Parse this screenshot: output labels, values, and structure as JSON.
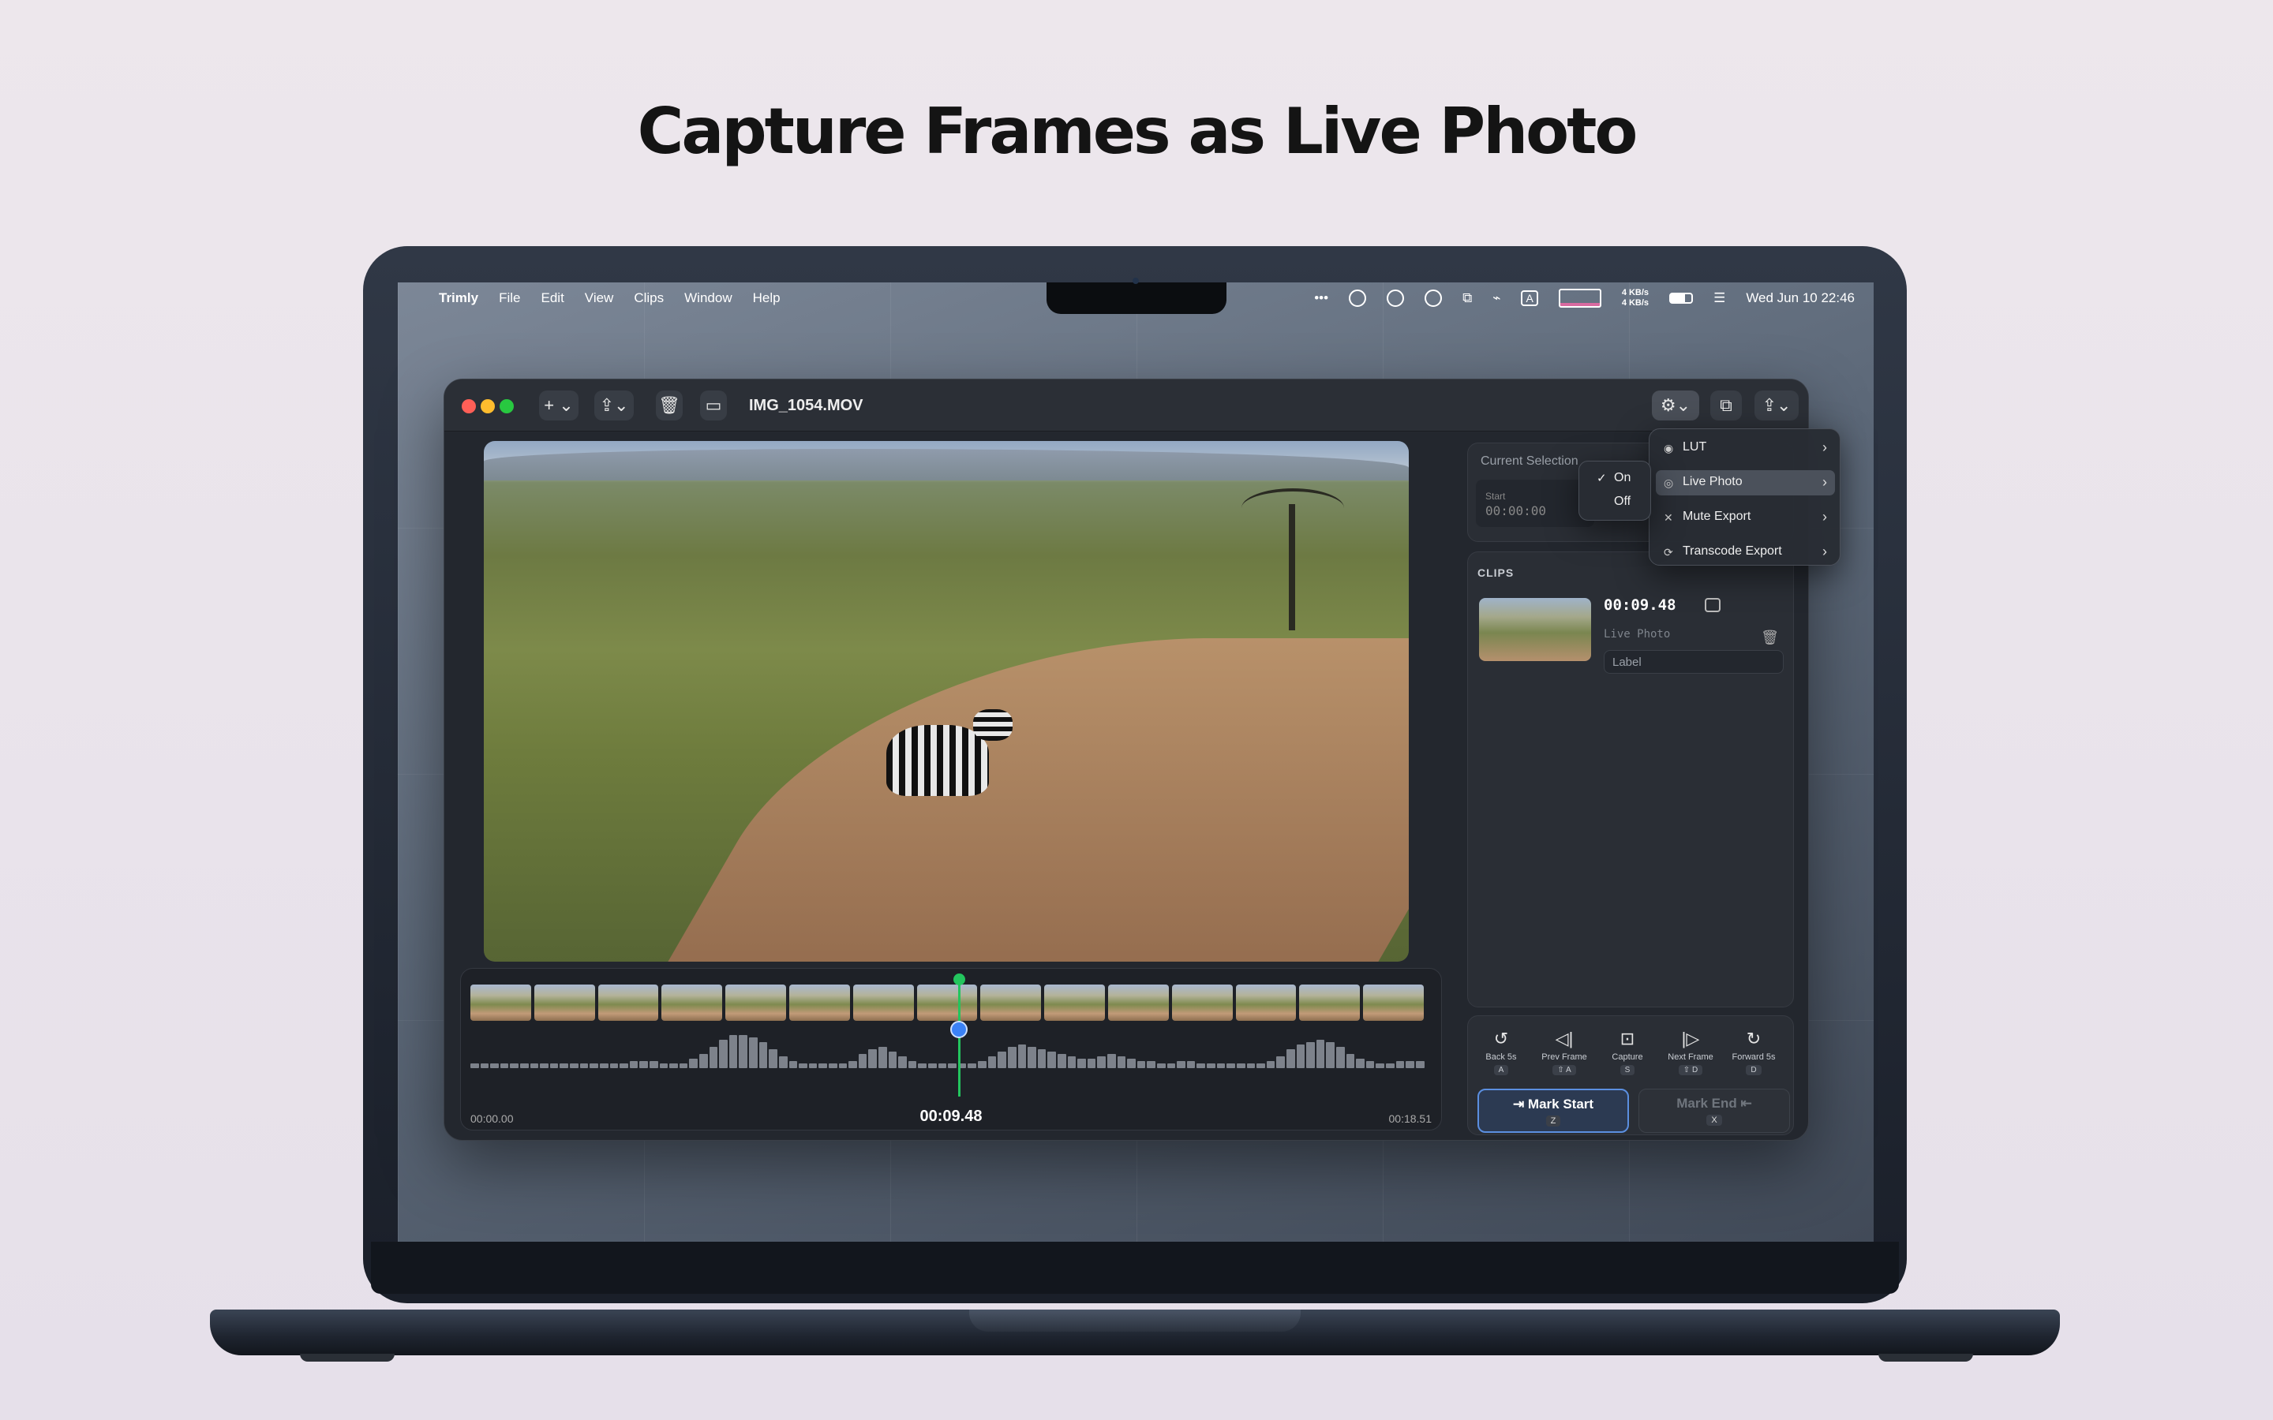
{
  "headline": "Capture Frames as Live Photo",
  "menubar": {
    "app": "Trimly",
    "items": [
      "File",
      "Edit",
      "View",
      "Clips",
      "Window",
      "Help"
    ],
    "net_up": "4 KB/s",
    "net_down": "4 KB/s",
    "clock": "Wed Jun 10  22:46"
  },
  "window": {
    "title": "IMG_1054.MOV",
    "toolbar_icons": [
      "add-icon",
      "share-icon",
      "trash-icon",
      "sidebar-icon",
      "settings-icon",
      "crop-icon",
      "export-icon"
    ]
  },
  "timeline": {
    "start": "00:00.00",
    "current": "00:09.48",
    "end": "00:18.51"
  },
  "selection": {
    "title": "Current Selection",
    "start_label": "Start",
    "start_value": "00:00:00"
  },
  "clips": {
    "title": "CLIPS",
    "items": [
      {
        "time": "00:09.48",
        "tag": "Live Photo",
        "label_placeholder": "Label"
      }
    ]
  },
  "controls": [
    {
      "label": "Back 5s",
      "key": "A",
      "icon": "back-5s-icon"
    },
    {
      "label": "Prev Frame",
      "key": "⇧ A",
      "icon": "prev-frame-icon"
    },
    {
      "label": "Capture",
      "key": "S",
      "icon": "capture-icon"
    },
    {
      "label": "Next Frame",
      "key": "⇧ D",
      "icon": "next-frame-icon"
    },
    {
      "label": "Forward 5s",
      "key": "D",
      "icon": "forward-5s-icon"
    }
  ],
  "mark_start": {
    "label": "Mark Start",
    "key": "Z"
  },
  "mark_end": {
    "label": "Mark End",
    "key": "X"
  },
  "settings_menu": {
    "items": [
      {
        "label": "LUT",
        "icon": "lut-icon"
      },
      {
        "label": "Live Photo",
        "icon": "live-photo-icon"
      },
      {
        "label": "Mute Export",
        "icon": "mute-icon"
      },
      {
        "label": "Transcode Export",
        "icon": "transcode-icon"
      }
    ]
  },
  "live_photo_submenu": {
    "items": [
      {
        "label": "On",
        "checked": true
      },
      {
        "label": "Off",
        "checked": false
      }
    ]
  },
  "colors": {
    "accent": "#3b82f6",
    "playhead": "#23c55e",
    "window_bg": "#23272e"
  }
}
